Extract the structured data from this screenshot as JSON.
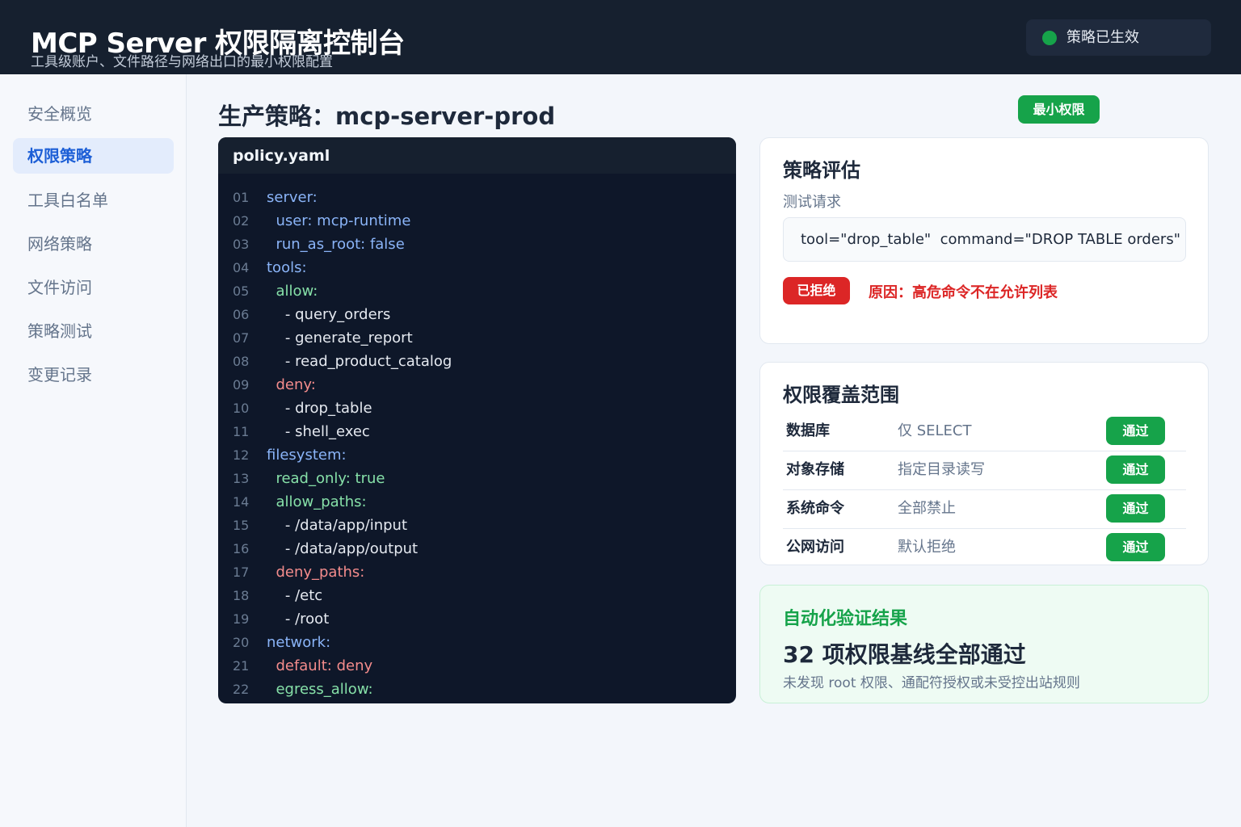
{
  "header": {
    "title": "MCP Server 权限隔离控制台",
    "subtitle": "工具级账户、文件路径与网络出口的最小权限配置",
    "status": "策略已生效"
  },
  "sidebar": {
    "items": [
      {
        "label": "安全概览"
      },
      {
        "label": "权限策略"
      },
      {
        "label": "工具白名单"
      },
      {
        "label": "网络策略"
      },
      {
        "label": "文件访问"
      },
      {
        "label": "策略测试"
      },
      {
        "label": "变更记录"
      }
    ],
    "active": "权限策略"
  },
  "main": {
    "title": "生产策略：mcp-server-prod",
    "badge": "最小权限"
  },
  "code": {
    "filename": "policy.yaml",
    "lines": [
      {
        "no": "01",
        "text": "server:",
        "kind": "key"
      },
      {
        "no": "02",
        "text": "  user: mcp-runtime",
        "kind": "key"
      },
      {
        "no": "03",
        "text": "  run_as_root: false",
        "kind": "key"
      },
      {
        "no": "04",
        "text": "tools:",
        "kind": "key"
      },
      {
        "no": "05",
        "text": "  allow:",
        "kind": "allow"
      },
      {
        "no": "06",
        "text": "    - query_orders",
        "kind": "plain"
      },
      {
        "no": "07",
        "text": "    - generate_report",
        "kind": "plain"
      },
      {
        "no": "08",
        "text": "    - read_product_catalog",
        "kind": "plain"
      },
      {
        "no": "09",
        "text": "  deny:",
        "kind": "deny"
      },
      {
        "no": "10",
        "text": "    - drop_table",
        "kind": "plain"
      },
      {
        "no": "11",
        "text": "    - shell_exec",
        "kind": "plain"
      },
      {
        "no": "12",
        "text": "filesystem:",
        "kind": "key"
      },
      {
        "no": "13",
        "text": "  read_only: true",
        "kind": "allow"
      },
      {
        "no": "14",
        "text": "  allow_paths:",
        "kind": "allow"
      },
      {
        "no": "15",
        "text": "    - /data/app/input",
        "kind": "plain"
      },
      {
        "no": "16",
        "text": "    - /data/app/output",
        "kind": "plain"
      },
      {
        "no": "17",
        "text": "  deny_paths:",
        "kind": "deny"
      },
      {
        "no": "18",
        "text": "    - /etc",
        "kind": "plain"
      },
      {
        "no": "19",
        "text": "    - /root",
        "kind": "plain"
      },
      {
        "no": "20",
        "text": "network:",
        "kind": "key"
      },
      {
        "no": "21",
        "text": "  default: deny",
        "kind": "deny"
      },
      {
        "no": "22",
        "text": "  egress_allow:",
        "kind": "allow"
      }
    ]
  },
  "evaluation": {
    "title": "策略评估",
    "request_label": "测试请求",
    "request_value": "tool=\"drop_table\"  command=\"DROP TABLE orders\"",
    "result_badge": "已拒绝",
    "reason": "原因：高危命令不在允许列表"
  },
  "scope": {
    "title": "权限覆盖范围",
    "rows": [
      {
        "name": "数据库",
        "value": "仅 SELECT",
        "status": "通过"
      },
      {
        "name": "对象存储",
        "value": "指定目录读写",
        "status": "通过"
      },
      {
        "name": "系统命令",
        "value": "全部禁止",
        "status": "通过"
      },
      {
        "name": "公网访问",
        "value": "默认拒绝",
        "status": "通过"
      }
    ]
  },
  "verification": {
    "title": "自动化验证结果",
    "headline": "32 项权限基线全部通过",
    "description": "未发现 root 权限、通配符授权或未受控出站规则"
  },
  "colors": {
    "header_bg": "#16202f",
    "accent_blue": "#1d5fd6",
    "success_green": "#16a34a",
    "danger_red": "#dc2626",
    "code_bg": "#0e1729"
  }
}
